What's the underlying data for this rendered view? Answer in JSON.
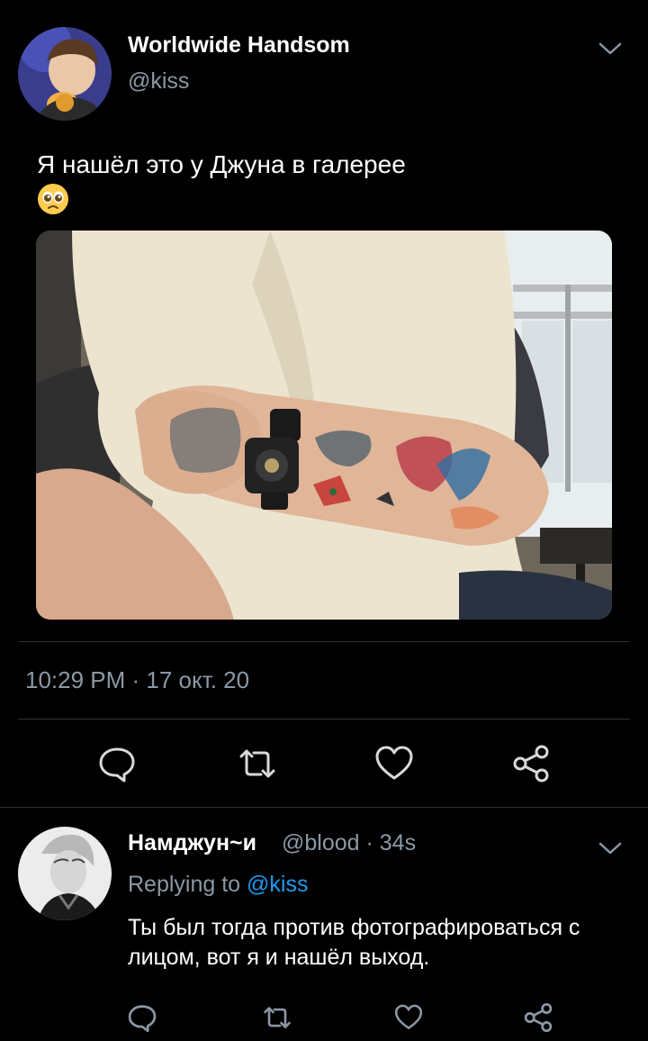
{
  "tweet": {
    "author_name": "Worldwide Handsom",
    "author_handle": "@kiss",
    "text": "Я нашёл это у Джуна в галерее",
    "emoji_name": "pleading-face",
    "timestamp": "10:29 PM · 17 окт. 20",
    "actions": {
      "reply_icon": "comment-icon",
      "retweet_icon": "retweet-icon",
      "like_icon": "heart-icon",
      "share_icon": "share-icon"
    }
  },
  "reply": {
    "author_name": "Намджун~и",
    "author_handle": "@blood · 34s",
    "replying_prefix": "Replying to",
    "replying_handle": "@kiss",
    "text": "Ты был тогда против фотографироваться с лицом, вот я и нашёл выход."
  },
  "colors": {
    "background": "#000000",
    "text": "#ffffff",
    "muted": "#8b98a5",
    "link": "#1d9bf0",
    "divider": "#2f3336"
  }
}
